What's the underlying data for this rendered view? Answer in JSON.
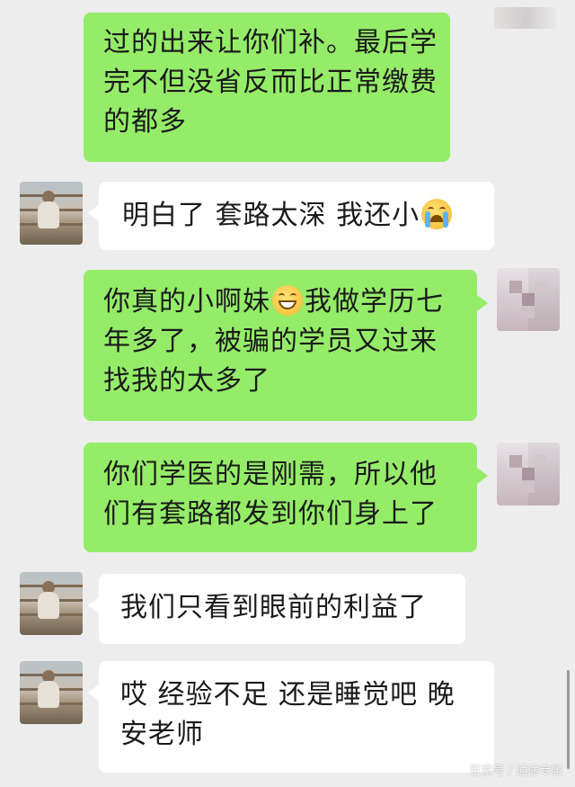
{
  "messages": [
    {
      "side": "me",
      "lines": [
        "过的出来让你们补。最后学",
        "完不但没省反而比正常缴费",
        "的都多"
      ]
    },
    {
      "side": "them",
      "lines": [
        "明白了 套路太深 我还小"
      ],
      "emoji_end": "crying-emoji"
    },
    {
      "side": "me",
      "lines": [
        "你真的小啊妹",
        "年多了，被骗的学员又过来",
        "找我的太多了"
      ],
      "line0_emoji": "grinning-emoji",
      "line0_after": "我做学历七"
    },
    {
      "side": "me",
      "lines": [
        "你们学医的是刚需，所以他",
        "们有套路都发到你们身上了"
      ]
    },
    {
      "side": "them",
      "lines": [
        "我们只看到眼前的利益了"
      ]
    },
    {
      "side": "them",
      "lines": [
        "哎 经验不足 还是睡觉吧 晚",
        "安老师"
      ]
    }
  ],
  "watermark": "百家号 / 通途专属"
}
